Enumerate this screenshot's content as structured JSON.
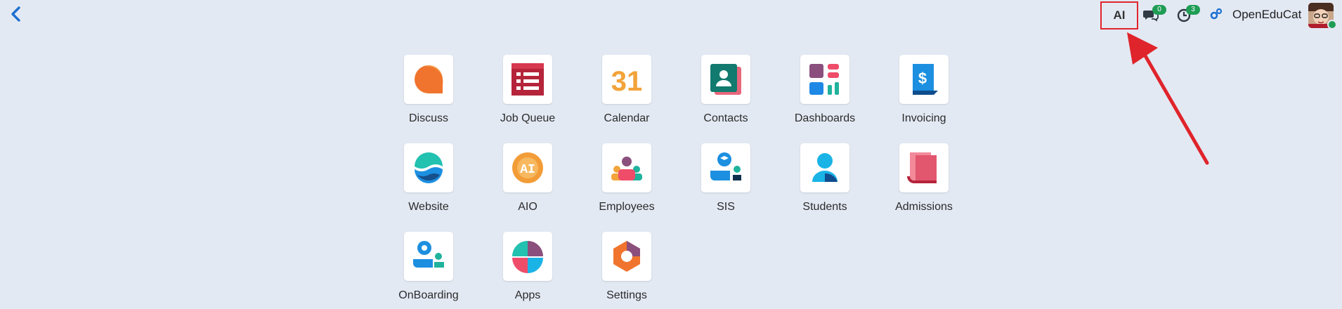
{
  "topbar": {
    "ai_label": "AI",
    "messages_count": "0",
    "activities_count": "3",
    "company_name": "OpenEduCat"
  },
  "apps": [
    {
      "label": "Discuss"
    },
    {
      "label": "Job Queue"
    },
    {
      "label": "Calendar",
      "icon_text": "31"
    },
    {
      "label": "Contacts"
    },
    {
      "label": "Dashboards"
    },
    {
      "label": "Invoicing",
      "icon_text": "$"
    },
    {
      "label": "Website"
    },
    {
      "label": "AIO",
      "icon_text": "AI"
    },
    {
      "label": "Employees"
    },
    {
      "label": "SIS"
    },
    {
      "label": "Students"
    },
    {
      "label": "Admissions"
    },
    {
      "label": "OnBoarding"
    },
    {
      "label": "Apps"
    },
    {
      "label": "Settings"
    }
  ],
  "colors": {
    "background": "#e3e9f3",
    "highlight": "#e0242b",
    "badge": "#1f9d55"
  }
}
